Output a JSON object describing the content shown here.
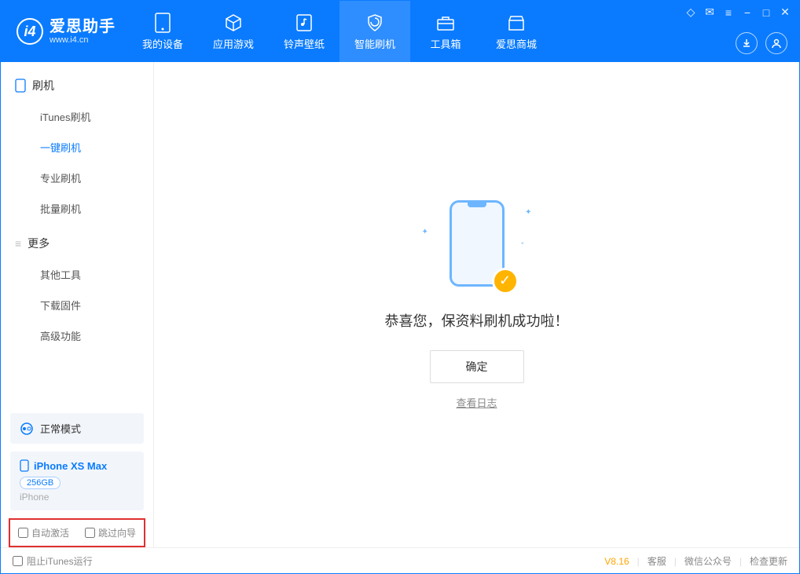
{
  "app": {
    "title": "爱思助手",
    "subtitle": "www.i4.cn"
  },
  "nav": {
    "tabs": [
      {
        "label": "我的设备",
        "icon": "device"
      },
      {
        "label": "应用游戏",
        "icon": "cube"
      },
      {
        "label": "铃声壁纸",
        "icon": "music"
      },
      {
        "label": "智能刷机",
        "icon": "shield"
      },
      {
        "label": "工具箱",
        "icon": "toolbox"
      },
      {
        "label": "爱思商城",
        "icon": "store"
      }
    ],
    "active_index": 3
  },
  "sidebar": {
    "sections": [
      {
        "title": "刷机",
        "items": [
          "iTunes刷机",
          "一键刷机",
          "专业刷机",
          "批量刷机"
        ],
        "active_index": 1
      },
      {
        "title": "更多",
        "items": [
          "其他工具",
          "下载固件",
          "高级功能"
        ],
        "active_index": -1
      }
    ],
    "mode": {
      "label": "正常模式"
    },
    "device": {
      "name": "iPhone XS Max",
      "storage": "256GB",
      "type": "iPhone"
    },
    "checkboxes": {
      "auto_activate": "自动激活",
      "skip_guide": "跳过向导"
    }
  },
  "main": {
    "success_text": "恭喜您，保资料刷机成功啦！",
    "ok_button": "确定",
    "view_log": "查看日志"
  },
  "footer": {
    "block_itunes": "阻止iTunes运行",
    "version": "V8.16",
    "links": [
      "客服",
      "微信公众号",
      "检查更新"
    ]
  }
}
